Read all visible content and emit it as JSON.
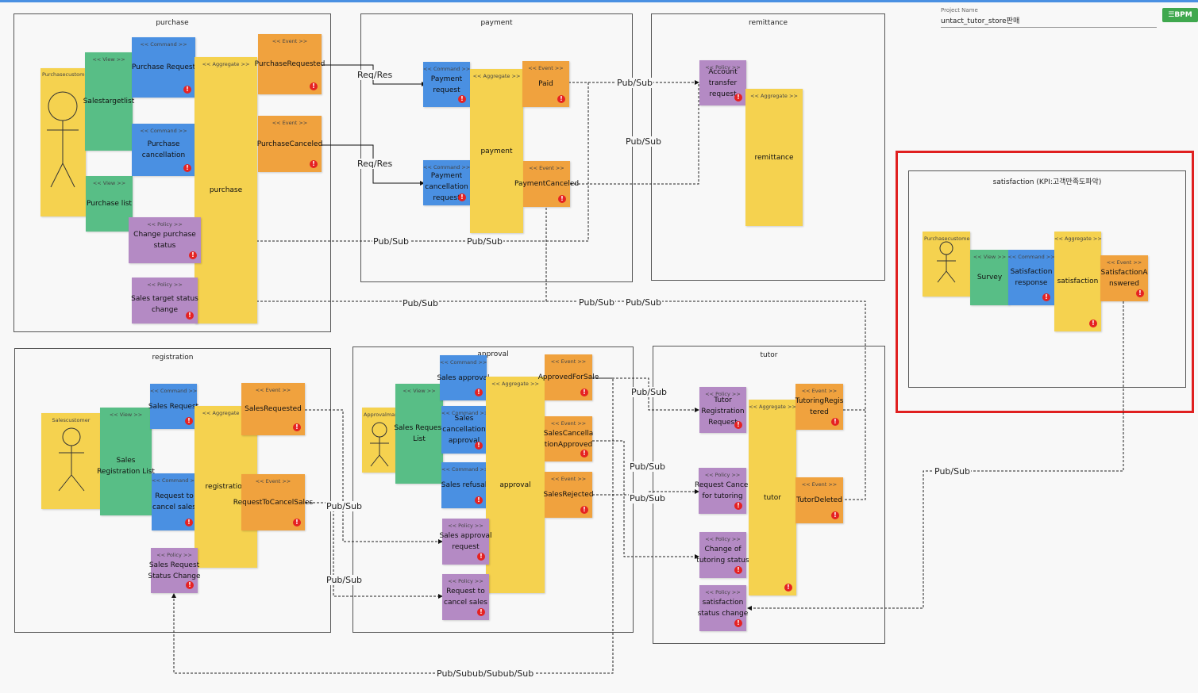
{
  "project": {
    "label": "Project Name",
    "name": "untact_tutor_store판매",
    "brand": "☰BPM"
  },
  "types": {
    "command": "<< Command >>",
    "event": "<< Event >>",
    "aggregate": "<< Aggregate >>",
    "policy": "<< Policy >>",
    "view": "<< View >>"
  },
  "contexts": {
    "purchase": "purchase",
    "payment": "payment",
    "remittance": "remittance",
    "registration": "registration",
    "approval": "approval",
    "tutor": "tutor",
    "satisfaction": "satisfaction (KPI:고객만족도파악)"
  },
  "stickies": {
    "purchase_actor": "Purchasecustomer",
    "salestargetlist": "Salestargetlist",
    "purchase_list": "Purchase list",
    "purchase_request": "Purchase Request",
    "purchase_cancellation": "Purchase cancellation",
    "purchase_agg": "purchase",
    "purchase_requested": "PurchaseRequested",
    "purchase_canceled": "PurchaseCanceled",
    "change_purchase_status": "Change purchase status",
    "sales_target_status_change": "Sales target status change",
    "payment_request": "Payment request",
    "payment_cancellation_request": "Payment cancellation request",
    "payment_agg": "payment",
    "paid": "Paid",
    "payment_canceled": "PaymentCanceled",
    "account_transfer_request": "Account transfer request",
    "remittance_agg": "remittance",
    "sales_actor": "Salescustomer",
    "sales_registration_list": "Sales Registration List",
    "sales_request": "Sales Request",
    "request_cancel_sales": "Request to cancel sales",
    "registration_agg": "registration",
    "sales_requested": "SalesRequested",
    "request_to_cancel_sales": "RequestToCancelSales",
    "sales_request_status_change": "Sales Request Status Change",
    "approval_actor": "Approvalmanager",
    "sales_request_list": "Sales Request List",
    "sales_approval": "Sales approval",
    "sales_cancellation_approval": "Sales cancellation approval",
    "sales_refusal": "Sales refusal",
    "approval_agg": "approval",
    "approved_for_sale": "ApprovedForSale",
    "sales_cancellation_approved": "SalesCancellationApproved",
    "sales_rejected": "SalesRejected",
    "sales_approval_request": "Sales approval request",
    "request_to_cancel_sales_policy": "Request to cancel sales",
    "tutor_registration_request": "Tutor Registration Request",
    "request_cancel_tutoring": "Request Cancel for tutoring",
    "change_tutoring_status": "Change of tutoring status",
    "satisfaction_status_change": "satisfaction status change",
    "tutor_agg": "tutor",
    "tutoring_registered": "TutoringRegistered",
    "tutor_deleted": "TutorDeleted",
    "satisfaction_actor": "Purchasecustomer",
    "survey": "Survey",
    "satisfaction_response": "Satisfaction response",
    "satisfaction_agg": "satisfaction",
    "satisfaction_answered": "SatisfactionAnswered"
  },
  "edge_labels": {
    "req_res_1": "Req/Res",
    "req_res_2": "Req/Res",
    "pub_paid": "Pub/Sub",
    "pub_canceled": "Pub/Sub",
    "pub_change_1": "Pub/Sub",
    "pub_change_2": "Pub/Sub",
    "pub_target_1": "Pub/Sub",
    "pub_target_2": "Pub/Sub",
    "pub_target_3": "Pub/Sub",
    "pub_reg_1": "Pub/Sub",
    "pub_reg_2": "Pub/Sub",
    "pub_appr_1": "Pub/Sub",
    "pub_appr_2": "Pub/Sub",
    "pub_appr_3": "Pub/Sub",
    "pub_sat": "Pub/Sub",
    "pub_bottom": "Pub/Subub/Subub/Sub"
  },
  "colors": {
    "command": "#4a90e2",
    "event": "#f0a23e",
    "aggregate": "#f5d24f",
    "policy": "#b48ac4",
    "view": "#58be86",
    "highlight": "#e02020"
  }
}
